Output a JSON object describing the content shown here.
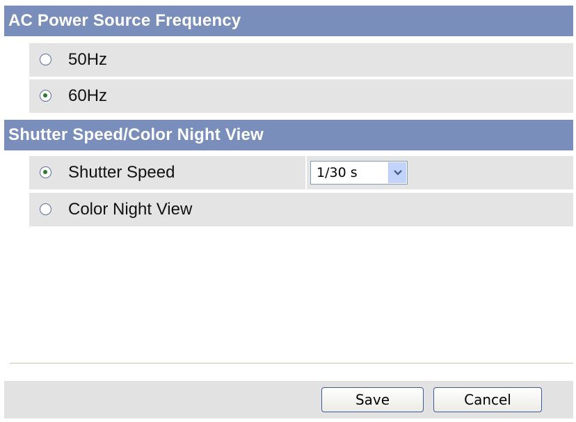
{
  "sections": [
    {
      "title": "AC Power Source Frequency",
      "options": [
        {
          "label": "50Hz",
          "checked": false
        },
        {
          "label": "60Hz",
          "checked": true
        }
      ]
    },
    {
      "title": "Shutter Speed/Color Night View",
      "options": [
        {
          "label": "Shutter Speed",
          "checked": true
        },
        {
          "label": "Color Night View",
          "checked": false
        }
      ]
    }
  ],
  "shutter_select": {
    "value": "1/30 s"
  },
  "footer": {
    "save_label": "Save",
    "cancel_label": "Cancel"
  },
  "colors": {
    "header_bg": "#7a8ebb",
    "row_bg": "#e4e4e4",
    "footer_bg": "#e2e2e2"
  }
}
